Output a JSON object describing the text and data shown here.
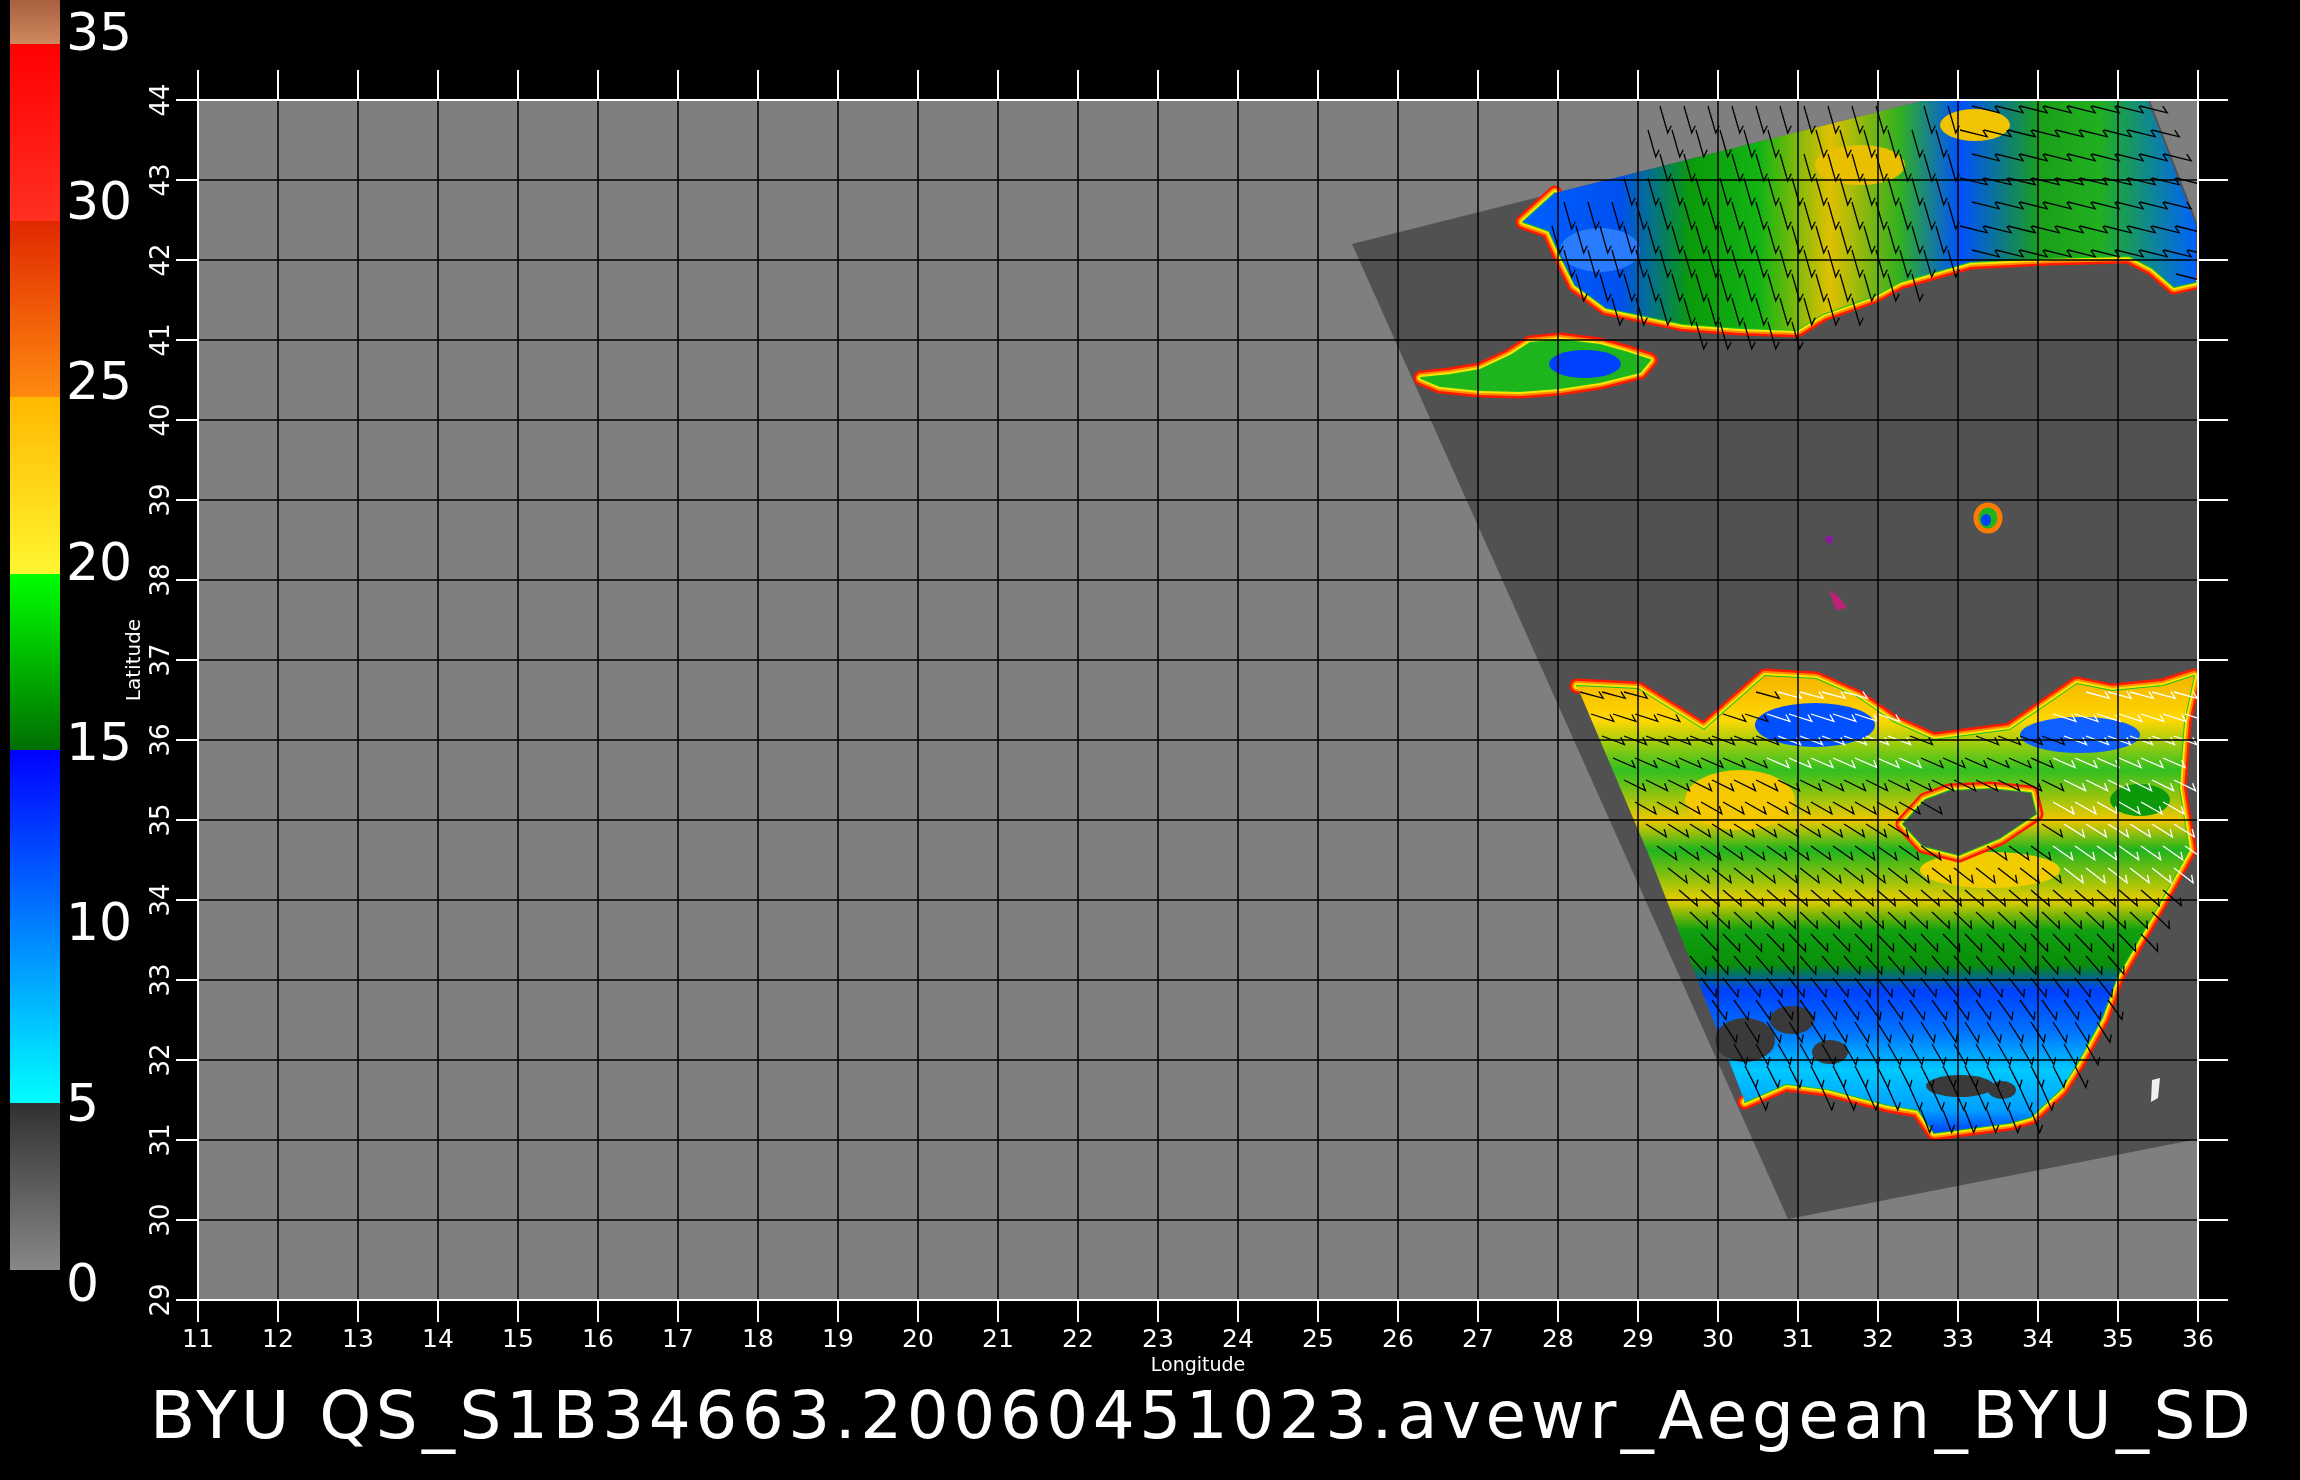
{
  "color_scale": {
    "labels": [
      "35",
      "30",
      "25",
      "20",
      "15",
      "10",
      "5",
      "0"
    ]
  },
  "map": {
    "y_axis": {
      "title": "Latitude",
      "ticks": [
        "29",
        "30",
        "31",
        "32",
        "33",
        "34",
        "35",
        "36",
        "37",
        "38",
        "39",
        "40",
        "41",
        "42",
        "43",
        "44"
      ]
    },
    "x_axis": {
      "title": "Longitude",
      "ticks": [
        "11",
        "12",
        "13",
        "14",
        "15",
        "16",
        "17",
        "18",
        "19",
        "20",
        "21",
        "22",
        "23",
        "24",
        "25",
        "26",
        "27",
        "28",
        "29",
        "30",
        "31",
        "32",
        "33",
        "34",
        "35",
        "36"
      ]
    }
  },
  "title": "BYU QS_S1B34663.20060451023.avewr_Aegean_BYU_SD"
}
